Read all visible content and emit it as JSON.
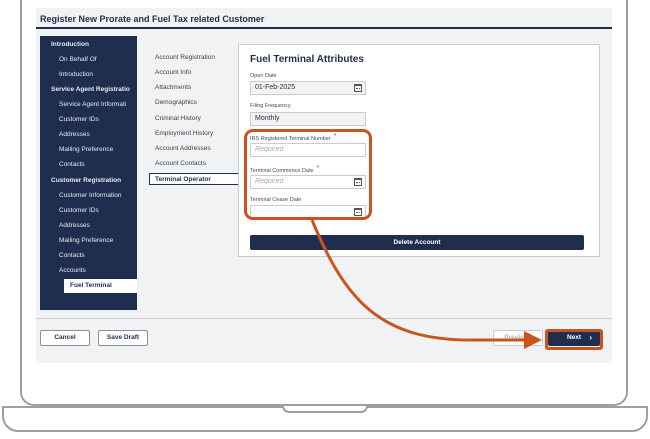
{
  "app": {
    "title": "Register New Prorate and Fuel Tax related Customer"
  },
  "sidebar": {
    "items": [
      {
        "label": "Introduction",
        "type": "head"
      },
      {
        "label": "On Behalf Of",
        "type": "sub"
      },
      {
        "label": "Introduction",
        "type": "sub"
      },
      {
        "label": "Service Agent Registratio",
        "type": "head"
      },
      {
        "label": "Service Agent Informati",
        "type": "sub"
      },
      {
        "label": "Customer IDs",
        "type": "sub"
      },
      {
        "label": "Addresses",
        "type": "sub"
      },
      {
        "label": "Mailing Preference",
        "type": "sub"
      },
      {
        "label": "Contacts",
        "type": "sub"
      },
      {
        "label": "Customer Registration",
        "type": "head"
      },
      {
        "label": "Customer Information",
        "type": "sub"
      },
      {
        "label": "Customer IDs",
        "type": "sub"
      },
      {
        "label": "Addresses",
        "type": "sub"
      },
      {
        "label": "Mailing Preference",
        "type": "sub"
      },
      {
        "label": "Contacts",
        "type": "sub"
      },
      {
        "label": "Accounts",
        "type": "sub"
      }
    ],
    "active_label": "Fuel Terminal"
  },
  "steps": {
    "items": [
      "Account Registration",
      "Account Info",
      "Attachments",
      "Demographics",
      "Criminal History",
      "Employment History",
      "Account Addresses",
      "Account Contacts"
    ],
    "active_label": "Terminal Operator"
  },
  "panel": {
    "title": "Fuel Terminal Attributes",
    "open_date": {
      "label": "Open Date",
      "value": "01-Feb-2025"
    },
    "filing_frequency": {
      "label": "Filing Frequency",
      "value": "Monthly"
    },
    "irs_number": {
      "label": "IRS Registered Terminal Number",
      "placeholder": "Required",
      "required_mark": "*"
    },
    "commence_date": {
      "label": "Terminal Commence Date",
      "placeholder": "Required",
      "required_mark": "*"
    },
    "cease_date": {
      "label": "Terminal Cease Date",
      "value": ""
    },
    "delete_label": "Delete Account"
  },
  "footer": {
    "cancel_label": "Cancel",
    "save_draft_label": "Save Draft",
    "previous_label": "Previous",
    "next_label": "Next",
    "next_chevron": "›"
  },
  "icons": {
    "calendar": "calendar-icon",
    "chevron": "chevron-right-icon"
  },
  "colors": {
    "navy": "#1f2d4e",
    "highlight": "#c9541d",
    "required": "#c0392b"
  }
}
